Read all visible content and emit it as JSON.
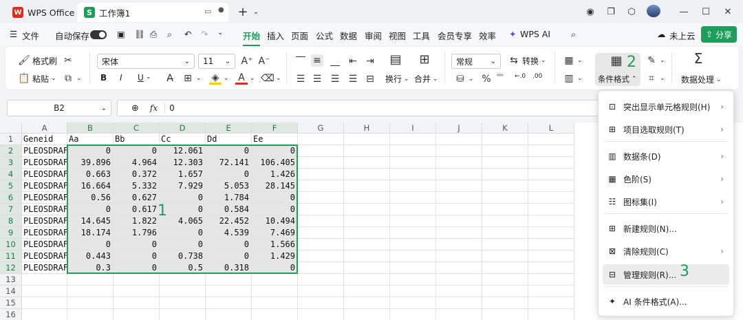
{
  "titlebar": {
    "app_tab": "WPS Office",
    "doc_tab": "工作簿1",
    "wps_logo": "W",
    "doc_logo": "S"
  },
  "menubar": {
    "file": "文件",
    "autosave": "自动保存",
    "tabs": [
      "开始",
      "插入",
      "页面",
      "公式",
      "数据",
      "审阅",
      "视图",
      "工具",
      "会员专享",
      "效率"
    ],
    "wps_ai": "WPS AI",
    "cloud": "未上云",
    "share": "分享"
  },
  "ribbon": {
    "format_painter": "格式刷",
    "paste": "粘贴",
    "font_name": "宋体",
    "font_size": "11",
    "wrap": "换行",
    "merge": "合并",
    "number_format": "常规",
    "convert": "转换",
    "cond_format": "条件格式",
    "data_process": "数据处理",
    "bold": "B",
    "italic": "I",
    "underline": "U"
  },
  "formulabar": {
    "name_box": "B2",
    "fx": "fx",
    "value": "0"
  },
  "grid": {
    "columns": [
      "A",
      "B",
      "C",
      "D",
      "E",
      "F",
      "G",
      "H",
      "I",
      "J",
      "K",
      "L"
    ],
    "rows": [
      "1",
      "2",
      "3",
      "4",
      "5",
      "6",
      "7",
      "8",
      "9",
      "10",
      "11",
      "12",
      "13",
      "14",
      "15",
      "16"
    ],
    "header_row": [
      "Geneid",
      "Aa",
      "Bb",
      "Cc",
      "Dd",
      "Ee"
    ],
    "data": [
      [
        "PLEOSDRAF",
        "0",
        "0",
        "12.061",
        "0",
        "0"
      ],
      [
        "PLEOSDRAF",
        "39.896",
        "4.964",
        "12.303",
        "72.141",
        "106.405"
      ],
      [
        "PLEOSDRAF",
        "0.663",
        "0.372",
        "1.657",
        "0",
        "1.426"
      ],
      [
        "PLEOSDRAF",
        "16.664",
        "5.332",
        "7.929",
        "5.053",
        "28.145"
      ],
      [
        "PLEOSDRAF",
        "0.56",
        "0.627",
        "0",
        "1.784",
        "0"
      ],
      [
        "PLEOSDRAF",
        "0",
        "0.617",
        "0",
        "0.584",
        "0"
      ],
      [
        "PLEOSDRAF",
        "14.645",
        "1.822",
        "4.065",
        "22.452",
        "10.494"
      ],
      [
        "PLEOSDRAF",
        "18.174",
        "1.796",
        "0",
        "4.539",
        "7.469"
      ],
      [
        "PLEOSDRAF",
        "0",
        "0",
        "0",
        "0",
        "1.566"
      ],
      [
        "PLEOSDRAF",
        "0.443",
        "0",
        "0.738",
        "0",
        "1.429"
      ],
      [
        "PLEOSDRAF",
        "0.3",
        "0",
        "0.5",
        "0.318",
        "0"
      ]
    ]
  },
  "annotations": {
    "a1": "1",
    "a2": "2",
    "a3": "3"
  },
  "dropdown": {
    "items": [
      {
        "label": "突出显示单元格规则(H)",
        "submenu": true
      },
      {
        "label": "项目选取规则(T)",
        "submenu": true
      },
      {
        "label": "数据条(D)",
        "submenu": true
      },
      {
        "label": "色阶(S)",
        "submenu": true
      },
      {
        "label": "图标集(I)",
        "submenu": true
      },
      {
        "label": "新建规则(N)...",
        "submenu": false
      },
      {
        "label": "清除规则(C)",
        "submenu": true
      },
      {
        "label": "管理规则(R)...",
        "submenu": false
      },
      {
        "label": "AI 条件格式(A)...",
        "submenu": false
      }
    ]
  },
  "colors": {
    "accent": "#1e9e5a",
    "wps_red": "#e02b20"
  }
}
